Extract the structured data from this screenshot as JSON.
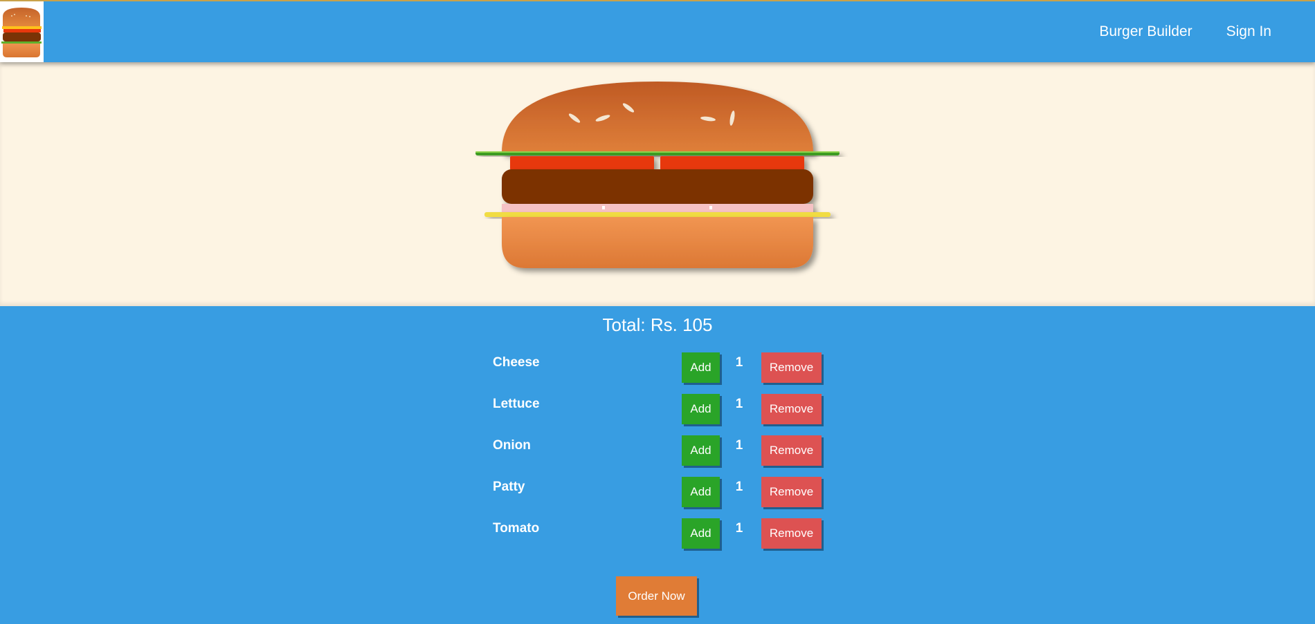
{
  "header": {
    "logo_icon": "burger-logo-icon",
    "nav": [
      {
        "label": "Burger Builder"
      },
      {
        "label": "Sign In"
      }
    ]
  },
  "burger": {
    "layers": [
      "bread-top",
      "lettuce",
      "tomato",
      "patty",
      "onion",
      "cheese",
      "bread-bottom"
    ]
  },
  "builder": {
    "total": "Total: Rs. 105",
    "controls": [
      {
        "label": "Cheese",
        "add": "Add",
        "count": "1",
        "remove": "Remove"
      },
      {
        "label": "Lettuce",
        "add": "Add",
        "count": "1",
        "remove": "Remove"
      },
      {
        "label": "Onion",
        "add": "Add",
        "count": "1",
        "remove": "Remove"
      },
      {
        "label": "Patty",
        "add": "Add",
        "count": "1",
        "remove": "Remove"
      },
      {
        "label": "Tomato",
        "add": "Add",
        "count": "1",
        "remove": "Remove"
      }
    ],
    "order_label": "Order Now"
  },
  "colors": {
    "primary": "#389de2",
    "stage_bg": "#fdf4e3",
    "add": "#2aa428",
    "remove": "#dd5252",
    "order": "#e07c36"
  }
}
